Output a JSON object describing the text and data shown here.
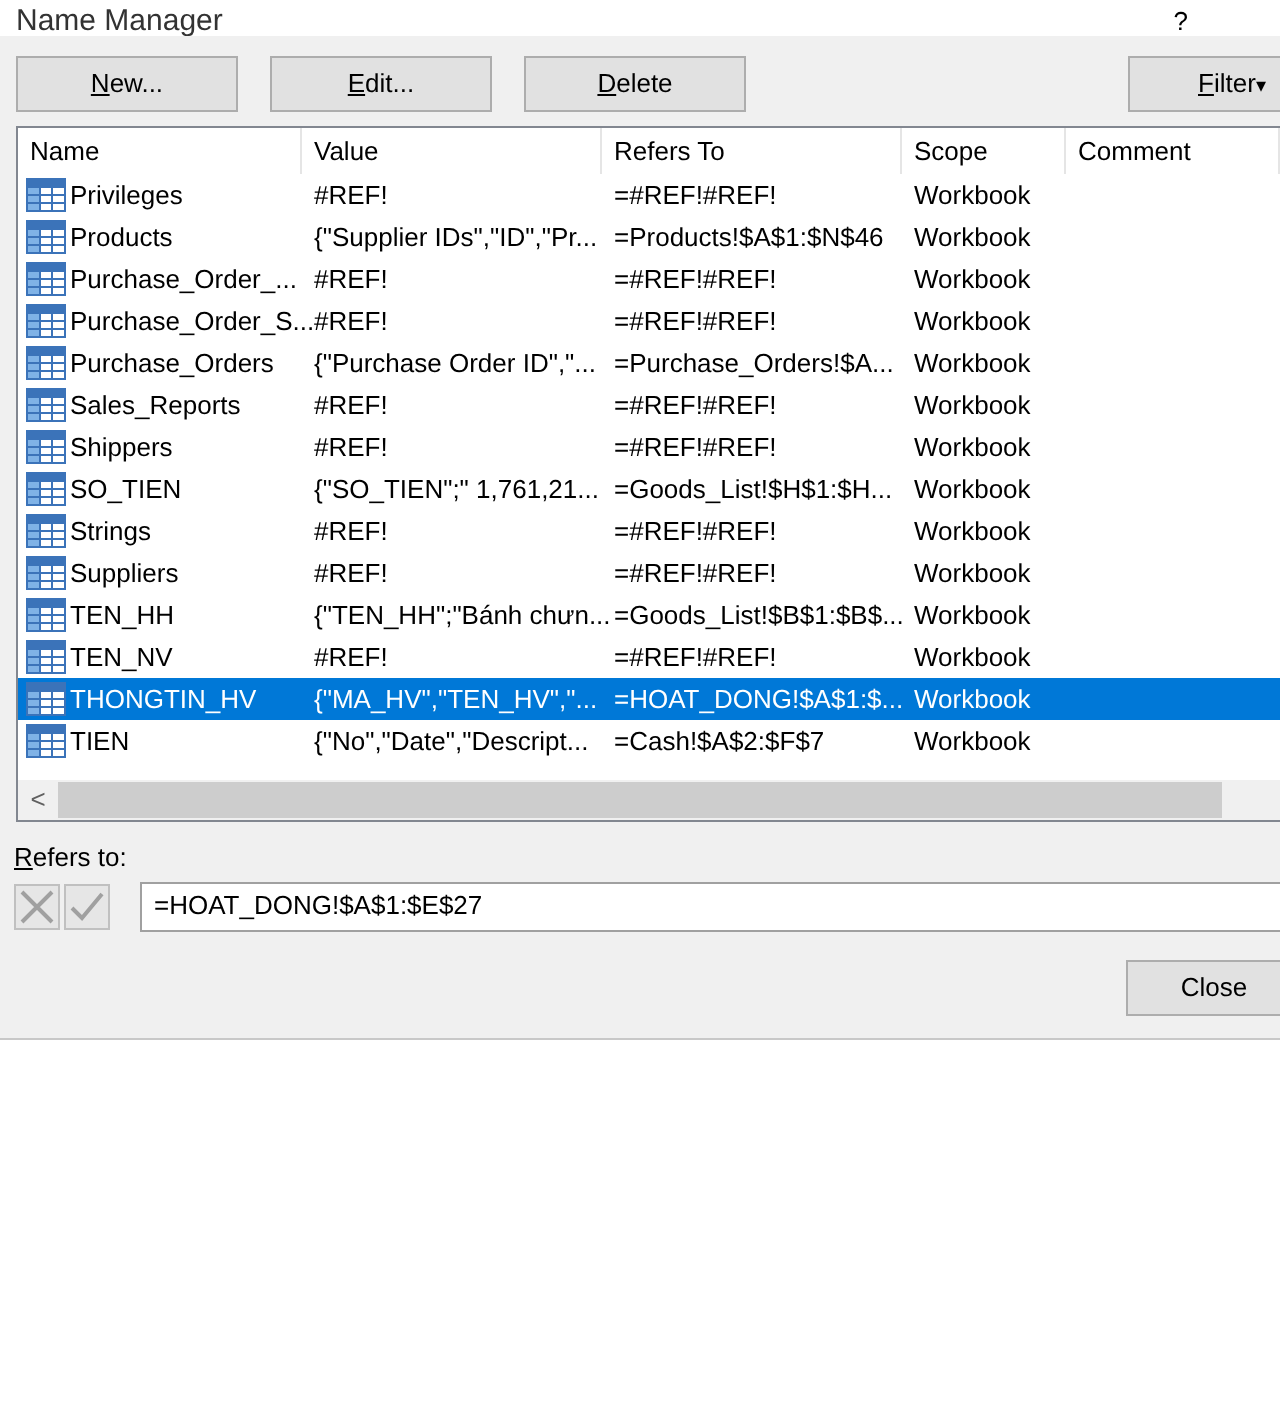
{
  "window": {
    "title": "Name Manager",
    "help": "?"
  },
  "buttons": [
    {
      "label": "New..."
    },
    {
      "label": "Edit..."
    },
    {
      "label": "Delete"
    }
  ],
  "filter_button": {
    "label": "Filter",
    "caret": "▾"
  },
  "table": {
    "columns": [
      "Name",
      "Value",
      "Refers To",
      "Scope",
      "Comment"
    ],
    "rows": [
      {
        "name": "Privileges",
        "value": "#REF!",
        "refers_to": "=#REF!#REF!",
        "scope": "Workbook",
        "selected": false
      },
      {
        "name": "Products",
        "value": "{\"Supplier IDs\",\"ID\",\"Pr...",
        "refers_to": "=Products!$A$1:$N$46",
        "scope": "Workbook",
        "selected": false
      },
      {
        "name": "Purchase_Order_...",
        "value": "#REF!",
        "refers_to": "=#REF!#REF!",
        "scope": "Workbook",
        "selected": false
      },
      {
        "name": "Purchase_Order_S...",
        "value": "#REF!",
        "refers_to": "=#REF!#REF!",
        "scope": "Workbook",
        "selected": false
      },
      {
        "name": "Purchase_Orders",
        "value": "{\"Purchase Order ID\",\"...",
        "refers_to": "=Purchase_Orders!$A...",
        "scope": "Workbook",
        "selected": false
      },
      {
        "name": "Sales_Reports",
        "value": "#REF!",
        "refers_to": "=#REF!#REF!",
        "scope": "Workbook",
        "selected": false
      },
      {
        "name": "Shippers",
        "value": "#REF!",
        "refers_to": "=#REF!#REF!",
        "scope": "Workbook",
        "selected": false
      },
      {
        "name": "SO_TIEN",
        "value": "{\"SO_TIEN\";\" 1,761,21...",
        "refers_to": "=Goods_List!$H$1:$H...",
        "scope": "Workbook",
        "selected": false
      },
      {
        "name": "Strings",
        "value": "#REF!",
        "refers_to": "=#REF!#REF!",
        "scope": "Workbook",
        "selected": false
      },
      {
        "name": "Suppliers",
        "value": "#REF!",
        "refers_to": "=#REF!#REF!",
        "scope": "Workbook",
        "selected": false
      },
      {
        "name": "TEN_HH",
        "value": "{\"TEN_HH\";\"Bánh chưn...",
        "refers_to": "=Goods_List!$B$1:$B$...",
        "scope": "Workbook",
        "selected": false
      },
      {
        "name": "TEN_NV",
        "value": "#REF!",
        "refers_to": "=#REF!#REF!",
        "scope": "Workbook",
        "selected": false
      },
      {
        "name": "THONGTIN_HV",
        "value": "{\"MA_HV\",\"TEN_HV\",\"...",
        "refers_to": "=HOAT_DONG!$A$1:$...",
        "scope": "Workbook",
        "selected": true
      },
      {
        "name": "TIEN",
        "value": "{\"No\",\"Date\",\"Descript...",
        "refers_to": "=Cash!$A$2:$F$7",
        "scope": "Workbook",
        "selected": false
      }
    ]
  },
  "scroll_left": "<",
  "refers_to": {
    "label": "Refers to:",
    "value": "=HOAT_DONG!$A$1:$E$27"
  },
  "close_button": {
    "label": "Close"
  }
}
